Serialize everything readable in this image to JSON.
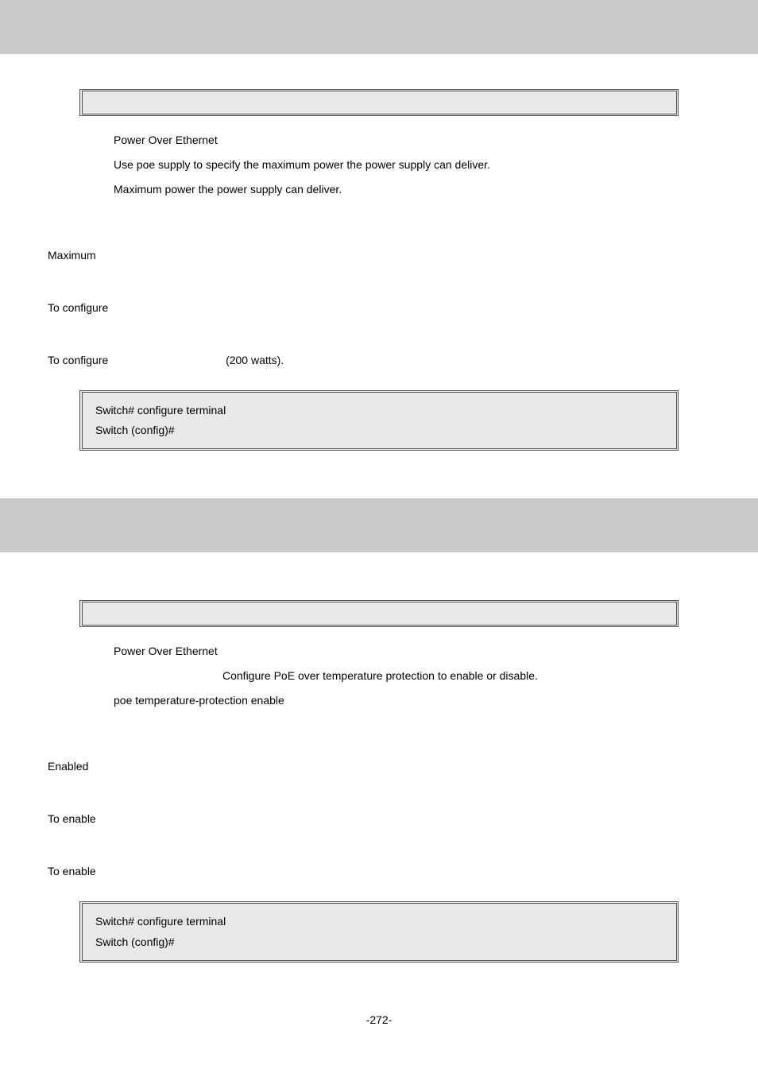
{
  "sec1": {
    "module": "Power Over Ethernet",
    "desc": "Use poe supply to specify the maximum power the power supply can deliver.",
    "param": " Maximum power the power supply can deliver.",
    "default": "Maximum",
    "usage": "To configure",
    "example_label": "To configure",
    "example_suffix": "(200 watts).",
    "code1": "Switch# configure terminal",
    "code2": "Switch (config)# "
  },
  "sec2": {
    "module": "Power Over Ethernet",
    "desc": "Configure PoE over temperature protection to enable or disable.",
    "param": " poe temperature-protection enable",
    "default": "Enabled",
    "usage": "To enable",
    "example_label": "To enable",
    "code1": "Switch# configure terminal",
    "code2": "Switch (config)# "
  },
  "footer": "-272-"
}
